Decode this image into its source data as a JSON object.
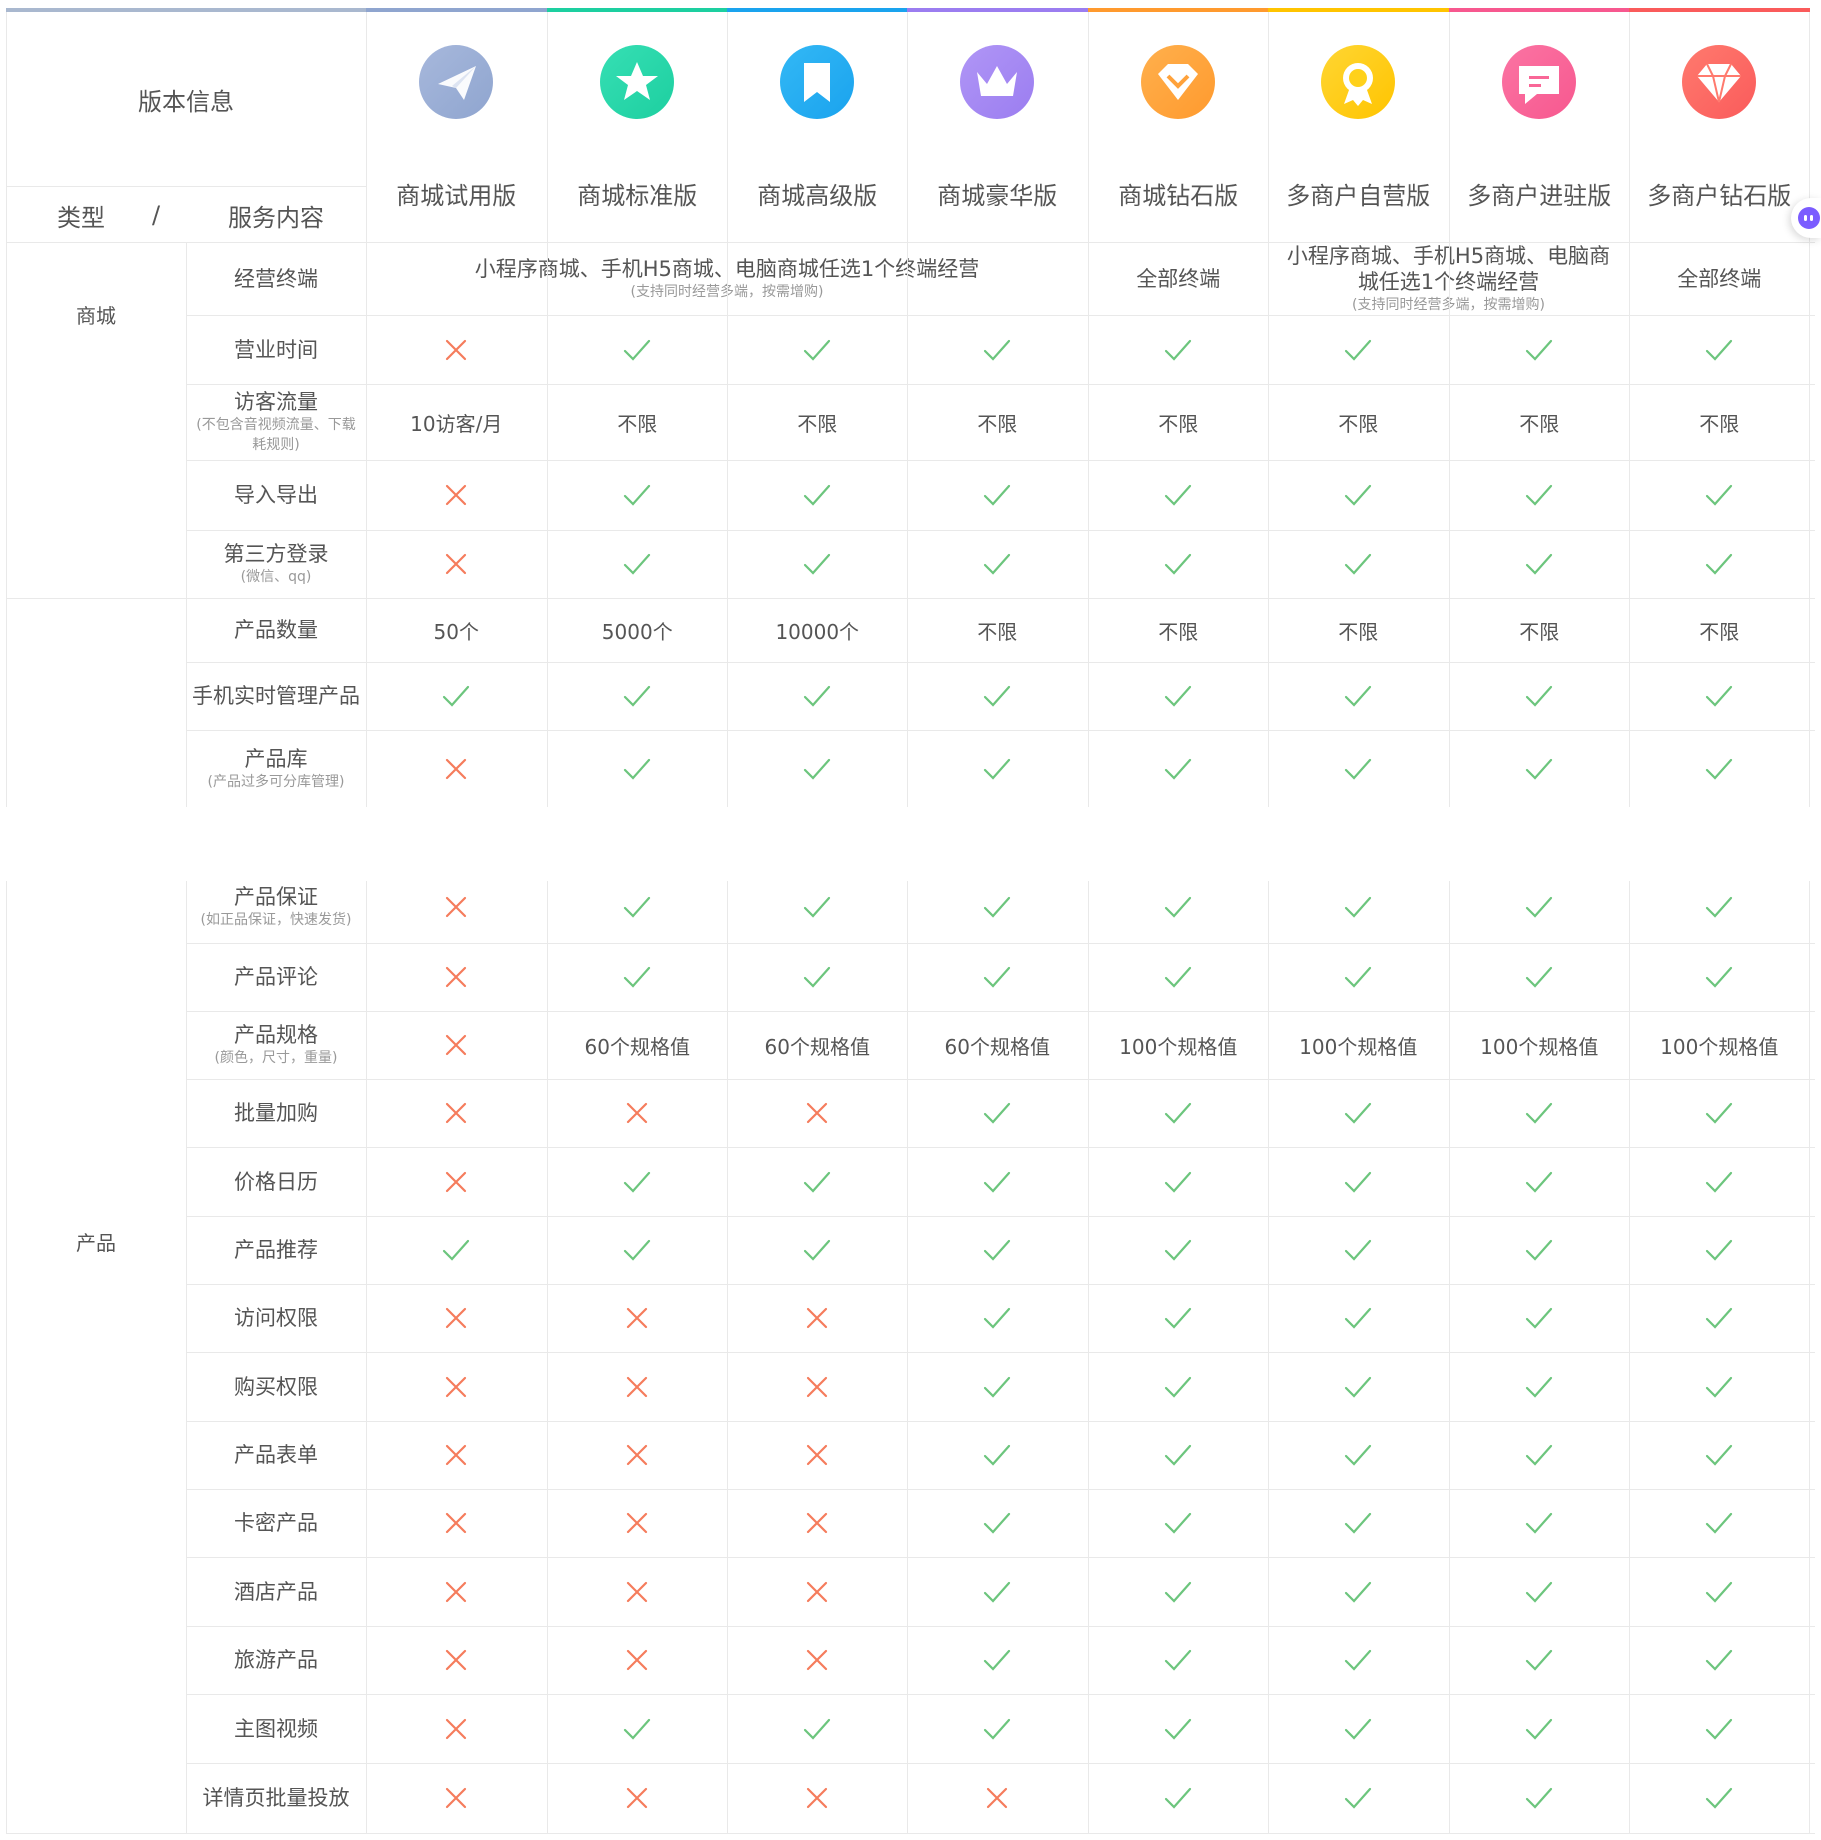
{
  "header": {
    "version_info": "版本信息",
    "type_label": "类型",
    "slash": "/",
    "service_label": "服务内容",
    "plans": [
      {
        "name": "商城试用版",
        "color": "#8fa5cf",
        "color2": "#a7b8dc",
        "icon": "paper-plane-icon"
      },
      {
        "name": "商城标准版",
        "color": "#1dcfa0",
        "color2": "#36dfb4",
        "icon": "star-icon"
      },
      {
        "name": "商城高级版",
        "color": "#1aa3ee",
        "color2": "#33b8f5",
        "icon": "bookmark-icon"
      },
      {
        "name": "商城豪华版",
        "color": "#9b7df0",
        "color2": "#b096f6",
        "icon": "crown-icon"
      },
      {
        "name": "商城钻石版",
        "color": "#ff9a2e",
        "color2": "#ffb04d",
        "icon": "gem-check-icon"
      },
      {
        "name": "多商户自营版",
        "color": "#ffc400",
        "color2": "#ffd633",
        "icon": "award-icon"
      },
      {
        "name": "多商户进驻版",
        "color": "#f7588f",
        "color2": "#fb74a3",
        "icon": "chat-icon"
      },
      {
        "name": "多商户钻石版",
        "color": "#fa5b5b",
        "color2": "#ff7a6e",
        "icon": "diamond-icon"
      }
    ]
  },
  "colors": {
    "check": "#6cc57d",
    "cross": "#f57c5c",
    "border": "#e9e9e9"
  },
  "categories": {
    "mall": "商城",
    "product": "产品"
  },
  "terminal_row": {
    "label": "经营终端",
    "span1": {
      "main": "小程序商城、手机H5商城、电脑商城任选1个终端经营",
      "sub": "(支持同时经营多端，按需增购)"
    },
    "diamond": "全部终端",
    "span2": {
      "main": "小程序商城、手机H5商城、电脑商城任选1个终端经营",
      "sub": "(支持同时经营多端，按需增购)"
    },
    "multi_diamond": "全部终端"
  },
  "rows1": [
    {
      "label": "营业时间",
      "cells": [
        "x",
        "v",
        "v",
        "v",
        "v",
        "v",
        "v",
        "v"
      ]
    },
    {
      "label": "访客流量",
      "sub": "(不包含音视频流量、下载耗规则)",
      "cells": [
        "10访客/月",
        "不限",
        "不限",
        "不限",
        "不限",
        "不限",
        "不限",
        "不限"
      ]
    },
    {
      "label": "导入导出",
      "cells": [
        "x",
        "v",
        "v",
        "v",
        "v",
        "v",
        "v",
        "v"
      ]
    },
    {
      "label": "第三方登录",
      "sub": "(微信、qq)",
      "cells": [
        "x",
        "v",
        "v",
        "v",
        "v",
        "v",
        "v",
        "v"
      ]
    },
    {
      "label": "产品数量",
      "cells": [
        "50个",
        "5000个",
        "10000个",
        "不限",
        "不限",
        "不限",
        "不限",
        "不限"
      ]
    },
    {
      "label": "手机实时管理产品",
      "cells": [
        "v",
        "v",
        "v",
        "v",
        "v",
        "v",
        "v",
        "v"
      ]
    },
    {
      "label": "产品库",
      "sub": "(产品过多可分库管理)",
      "cells": [
        "x",
        "v",
        "v",
        "v",
        "v",
        "v",
        "v",
        "v"
      ]
    }
  ],
  "rows2": [
    {
      "label": "产品保证",
      "sub": "(如正品保证，快速发货)",
      "cells": [
        "x",
        "v",
        "v",
        "v",
        "v",
        "v",
        "v",
        "v"
      ]
    },
    {
      "label": "产品评论",
      "cells": [
        "x",
        "v",
        "v",
        "v",
        "v",
        "v",
        "v",
        "v"
      ]
    },
    {
      "label": "产品规格",
      "sub": "(颜色，尺寸，重量)",
      "cells": [
        "x",
        "60个规格值",
        "60个规格值",
        "60个规格值",
        "100个规格值",
        "100个规格值",
        "100个规格值",
        "100个规格值"
      ]
    },
    {
      "label": "批量加购",
      "cells": [
        "x",
        "x",
        "x",
        "v",
        "v",
        "v",
        "v",
        "v"
      ]
    },
    {
      "label": "价格日历",
      "cells": [
        "x",
        "v",
        "v",
        "v",
        "v",
        "v",
        "v",
        "v"
      ]
    },
    {
      "label": "产品推荐",
      "cells": [
        "v",
        "v",
        "v",
        "v",
        "v",
        "v",
        "v",
        "v"
      ]
    },
    {
      "label": "访问权限",
      "cells": [
        "x",
        "x",
        "x",
        "v",
        "v",
        "v",
        "v",
        "v"
      ]
    },
    {
      "label": "购买权限",
      "cells": [
        "x",
        "x",
        "x",
        "v",
        "v",
        "v",
        "v",
        "v"
      ]
    },
    {
      "label": "产品表单",
      "cells": [
        "x",
        "x",
        "x",
        "v",
        "v",
        "v",
        "v",
        "v"
      ]
    },
    {
      "label": "卡密产品",
      "cells": [
        "x",
        "x",
        "x",
        "v",
        "v",
        "v",
        "v",
        "v"
      ]
    },
    {
      "label": "酒店产品",
      "cells": [
        "x",
        "x",
        "x",
        "v",
        "v",
        "v",
        "v",
        "v"
      ]
    },
    {
      "label": "旅游产品",
      "cells": [
        "x",
        "x",
        "x",
        "v",
        "v",
        "v",
        "v",
        "v"
      ]
    },
    {
      "label": "主图视频",
      "cells": [
        "x",
        "v",
        "v",
        "v",
        "v",
        "v",
        "v",
        "v"
      ]
    },
    {
      "label": "详情页批量投放",
      "cells": [
        "x",
        "x",
        "x",
        "x",
        "v",
        "v",
        "v",
        "v"
      ]
    }
  ]
}
